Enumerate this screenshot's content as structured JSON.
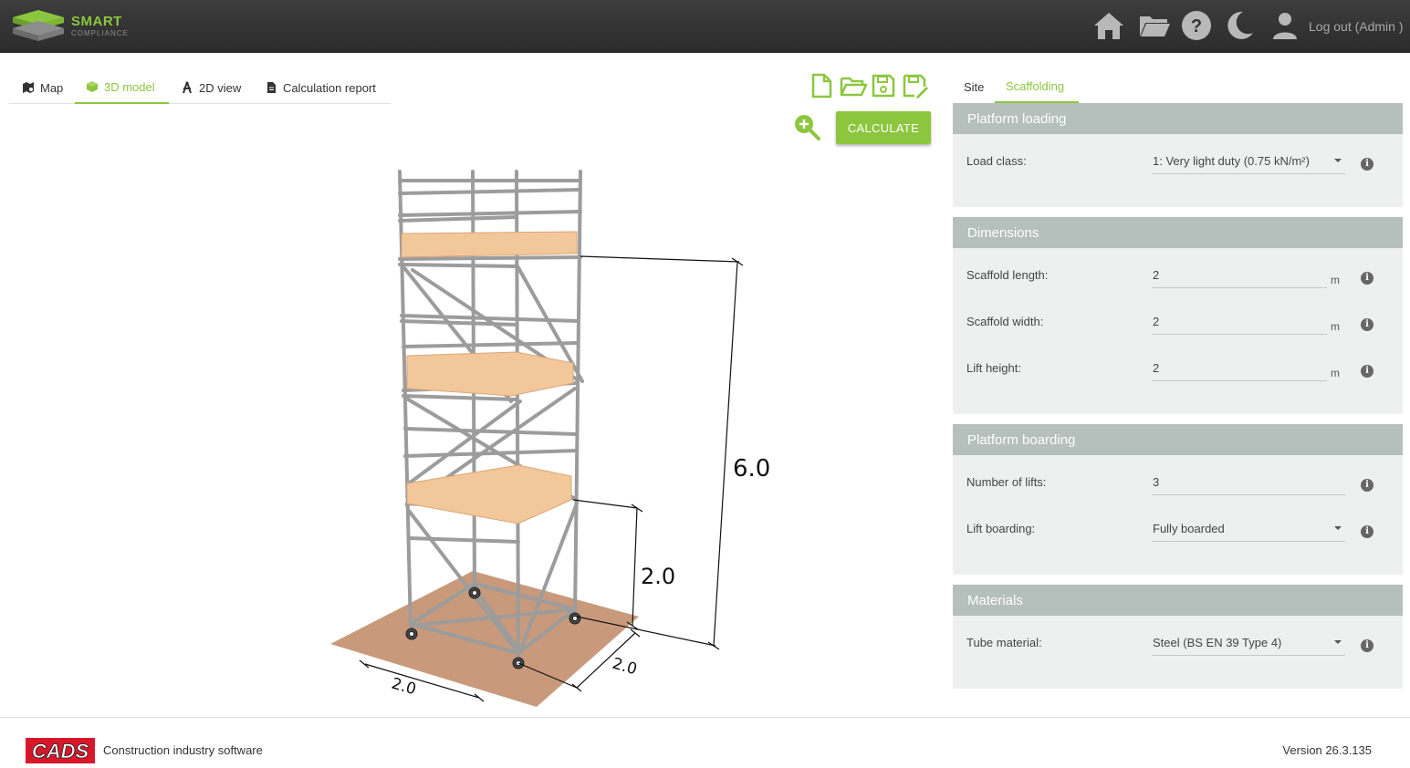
{
  "header": {
    "logo_text": "SMART",
    "logo_sub": "COMPLIANCE",
    "logout_label": "Log out (Admin )",
    "accent": "#8cc63f"
  },
  "tabs": [
    {
      "label": "Map",
      "icon": "map-icon"
    },
    {
      "label": "3D model",
      "icon": "cube-icon",
      "active": true
    },
    {
      "label": "2D view",
      "icon": "compass-icon"
    },
    {
      "label": "Calculation report",
      "icon": "document-icon"
    }
  ],
  "toolbar": {
    "calculate_label": "CALCULATE"
  },
  "model": {
    "dim_height": "6.0",
    "dim_lift": "2.0",
    "dim_length": "2.0",
    "dim_width": "2.0"
  },
  "right_tabs": [
    {
      "label": "Site"
    },
    {
      "label": "Scaffolding",
      "active": true
    }
  ],
  "sections": {
    "platform_loading": {
      "title": "Platform loading",
      "load_class_label": "Load class:",
      "load_class_value": "1: Very light duty (0.75 kN/m²)"
    },
    "dimensions": {
      "title": "Dimensions",
      "length_label": "Scaffold length:",
      "length_value": "2",
      "width_label": "Scaffold width:",
      "width_value": "2",
      "lift_label": "Lift height:",
      "lift_value": "2",
      "unit": "m"
    },
    "platform_boarding": {
      "title": "Platform boarding",
      "lifts_label": "Number of lifts:",
      "lifts_value": "3",
      "boarding_label": "Lift boarding:",
      "boarding_value": "Fully boarded"
    },
    "materials": {
      "title": "Materials",
      "tube_label": "Tube material:",
      "tube_value": "Steel (BS EN 39 Type 4)"
    }
  },
  "footer": {
    "brand": "CADS",
    "tagline": "Construction industry software",
    "version": "Version 26.3.135"
  }
}
